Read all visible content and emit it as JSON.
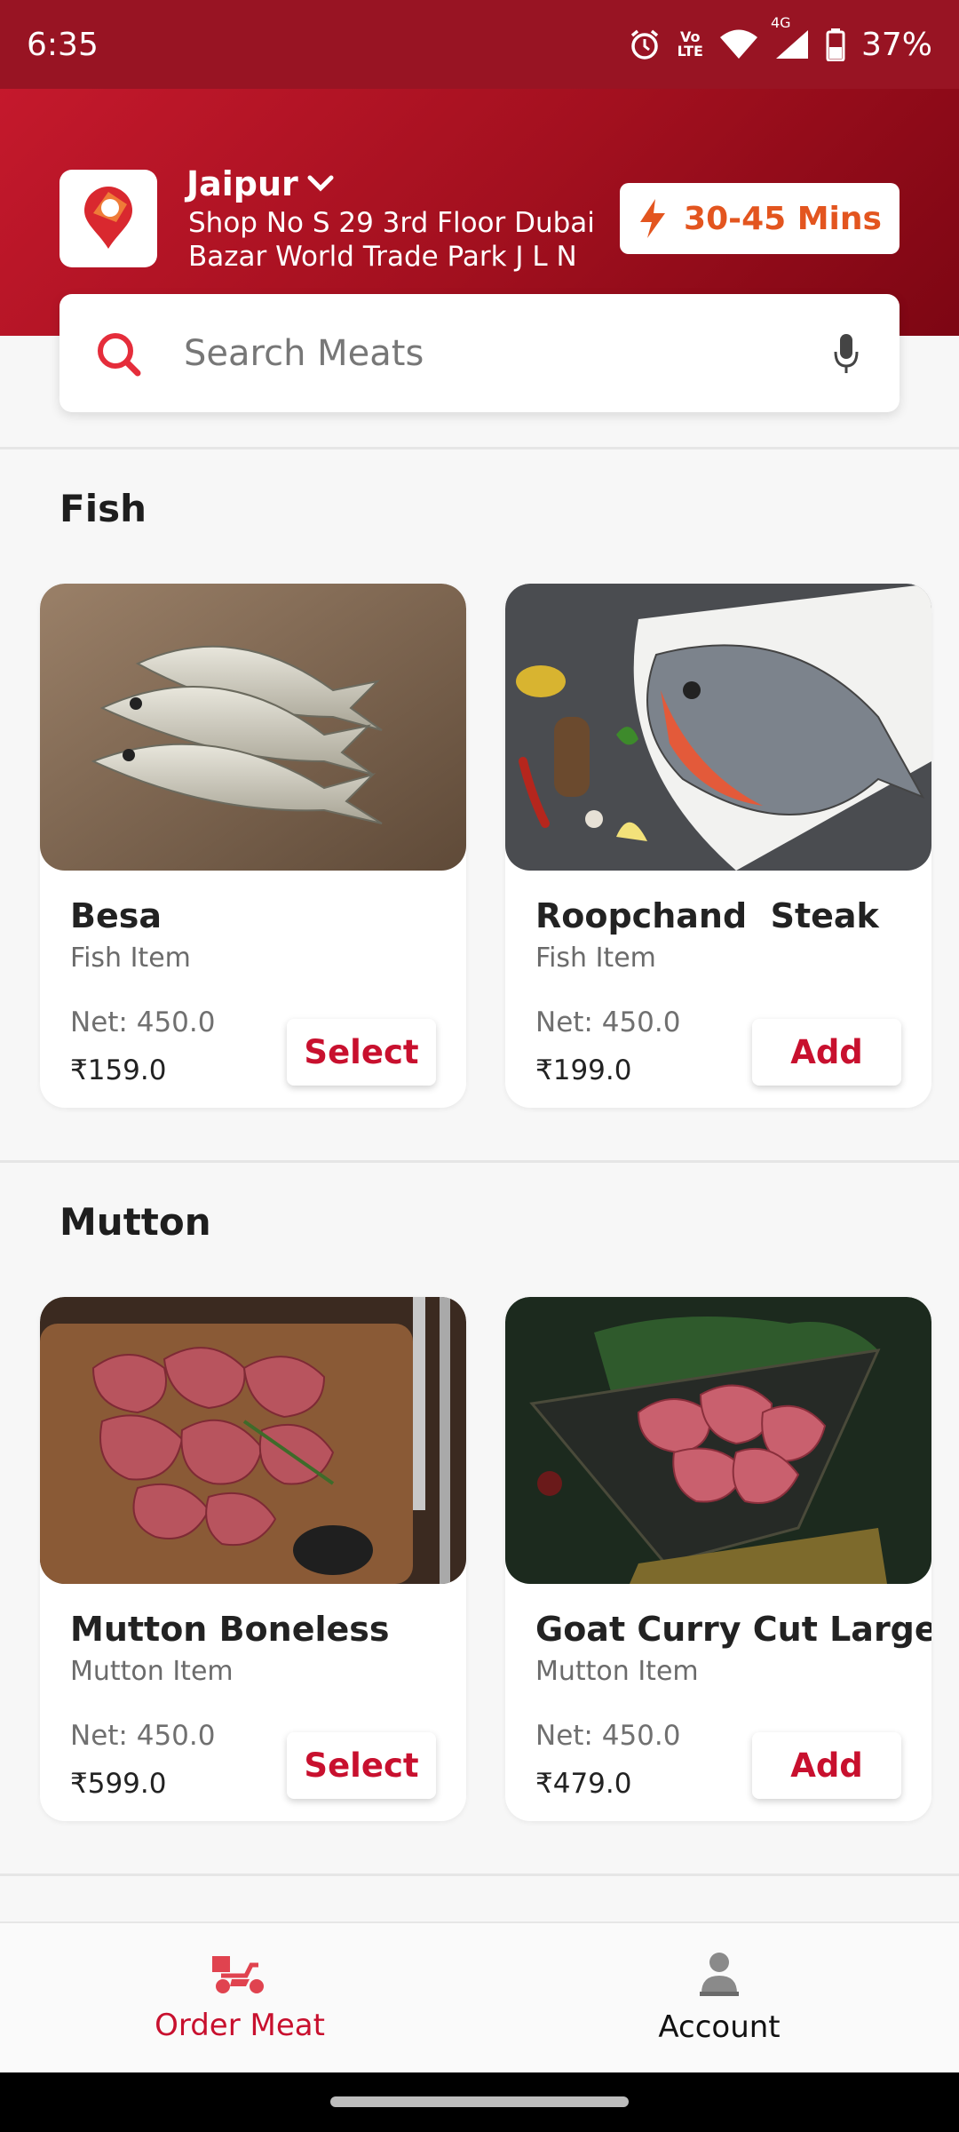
{
  "status_bar": {
    "time": "6:35",
    "battery": "37%",
    "network_4g": "4G",
    "lte_top": "Vo",
    "lte_bottom": "LTE"
  },
  "header": {
    "city": "Jaipur",
    "address": "Shop No S 29 3rd Floor Dubai Bazar World Trade Park J L N",
    "eta": "30-45 Mins"
  },
  "search": {
    "placeholder": "Search Meats"
  },
  "sections": [
    {
      "title": "Fish",
      "products": [
        {
          "name": "Besa",
          "subtitle": "Fish Item",
          "net": "Net: 450.0",
          "price": "₹159.0",
          "action": "Select"
        },
        {
          "name": "Roopchand  Steak",
          "subtitle": "Fish Item",
          "net": "Net: 450.0",
          "price": "₹199.0",
          "action": "Add"
        }
      ]
    },
    {
      "title": "Mutton",
      "products": [
        {
          "name": "Mutton Boneless",
          "subtitle": "Mutton Item",
          "net": "Net: 450.0",
          "price": "₹599.0",
          "action": "Select"
        },
        {
          "name": "Goat Curry Cut Large",
          "subtitle": "Mutton Item",
          "net": "Net: 450.0",
          "price": "₹479.0",
          "action": "Add"
        }
      ]
    }
  ],
  "bottom_nav": {
    "order_label": "Order Meat",
    "account_label": "Account"
  },
  "colors": {
    "brand": "#c8102e",
    "eta": "#e3551f",
    "header_dark": "#7d0613"
  }
}
